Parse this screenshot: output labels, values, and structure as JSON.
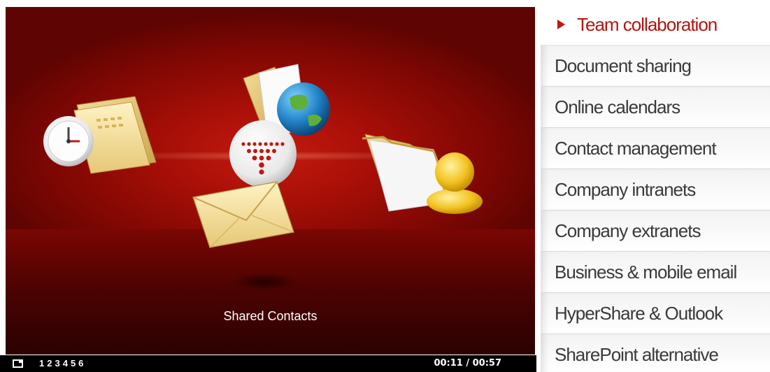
{
  "player": {
    "caption": "Shared Contacts",
    "chapters": [
      "1",
      "2",
      "3",
      "4",
      "5",
      "6"
    ],
    "timecode": "00:11 / 00:57"
  },
  "menu": {
    "items": [
      {
        "label": "Team collaboration",
        "active": true
      },
      {
        "label": "Document sharing"
      },
      {
        "label": "Online calendars"
      },
      {
        "label": "Contact management"
      },
      {
        "label": "Company intranets"
      },
      {
        "label": "Company extranets"
      },
      {
        "label": "Business & mobile email"
      },
      {
        "label": "HyperShare & Outlook"
      },
      {
        "label": "SharePoint alternative"
      }
    ]
  },
  "colors": {
    "accent": "#b41510",
    "stage_red": "#a80f07",
    "menu_text": "#3a3a3a"
  }
}
